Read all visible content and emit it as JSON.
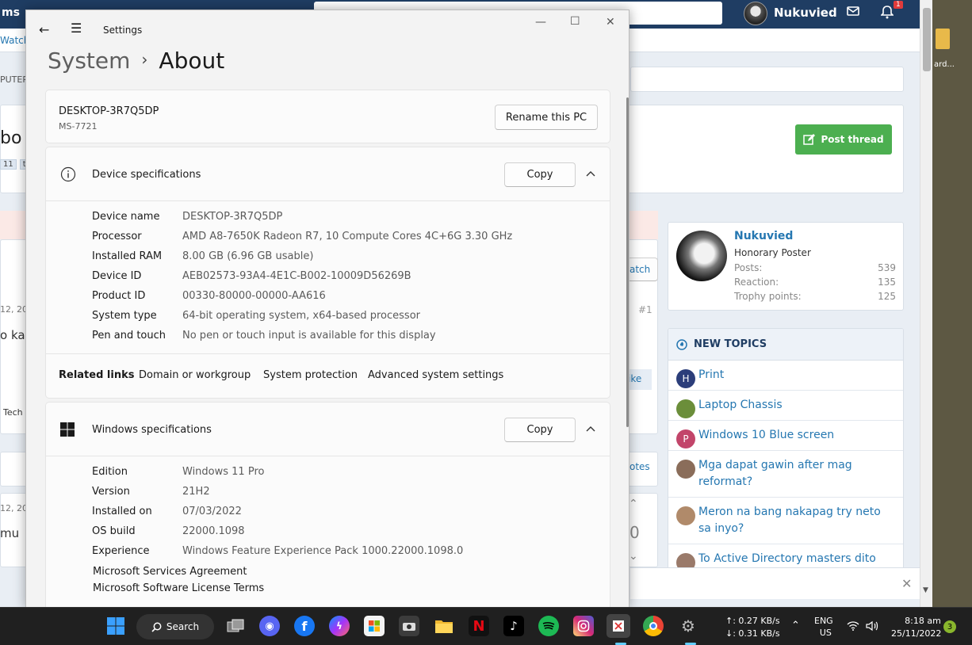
{
  "background_forum": {
    "nav_partial": "ms",
    "watch_partial": "Watch",
    "computer_partial": "PUTER",
    "title_partial": "bo",
    "tags": [
      "11",
      "t"
    ],
    "date_partial_1": "12, 202",
    "text_partial_1": "o ka",
    "tech_partial": "Tech",
    "date_partial_2": "12, 202",
    "text_partial_2": "mu",
    "watch_btn_partial": "atch",
    "post_number": "#1",
    "like_partial": "ike",
    "votes_partial": "otes",
    "vote_count": "0",
    "user_name": "Nukuvied",
    "post_thread_label": "Post thread",
    "desktop_label": "ard...",
    "profile": {
      "name": "Nukuvied",
      "rank": "Honorary Poster",
      "stats": [
        {
          "label": "Posts:",
          "value": "539"
        },
        {
          "label": "Reaction:",
          "value": "135"
        },
        {
          "label": "Trophy points:",
          "value": "125"
        }
      ]
    },
    "new_topics": {
      "heading": "NEW TOPICS",
      "items": [
        {
          "title": "Print",
          "avatar_letter": "H",
          "avatar_color": "#2c3e7a"
        },
        {
          "title": "Laptop Chassis",
          "avatar_letter": "",
          "avatar_color": "#6b8e3a"
        },
        {
          "title": "Windows 10 Blue screen",
          "avatar_letter": "P",
          "avatar_color": "#c2456a"
        },
        {
          "title": "Mga dapat gawin after mag reformat?",
          "avatar_letter": "",
          "avatar_color": "#8a6d5a"
        },
        {
          "title": "Meron na bang nakapag try neto sa inyo?",
          "avatar_letter": "",
          "avatar_color": "#b08a6a"
        },
        {
          "title": "To Active Directory masters dito",
          "avatar_letter": "",
          "avatar_color": "#9a7a6a"
        }
      ]
    }
  },
  "settings": {
    "window_title": "Settings",
    "breadcrumb_parent": "System",
    "breadcrumb_current": "About",
    "pc_name": "DESKTOP-3R7Q5DP",
    "pc_model": "MS-7721",
    "rename_button": "Rename this PC",
    "device_specs": {
      "heading": "Device specifications",
      "copy_button": "Copy",
      "rows": [
        {
          "label": "Device name",
          "value": "DESKTOP-3R7Q5DP"
        },
        {
          "label": "Processor",
          "value": "AMD A8-7650K Radeon R7, 10 Compute Cores 4C+6G    3.30 GHz"
        },
        {
          "label": "Installed RAM",
          "value": "8.00 GB (6.96 GB usable)"
        },
        {
          "label": "Device ID",
          "value": "AEB02573-93A4-4E1C-B002-10009D56269B"
        },
        {
          "label": "Product ID",
          "value": "00330-80000-00000-AA616"
        },
        {
          "label": "System type",
          "value": "64-bit operating system, x64-based processor"
        },
        {
          "label": "Pen and touch",
          "value": "No pen or touch input is available for this display"
        }
      ]
    },
    "related_links": {
      "label": "Related links",
      "links": [
        "Domain or workgroup",
        "System protection",
        "Advanced system settings"
      ]
    },
    "windows_specs": {
      "heading": "Windows specifications",
      "copy_button": "Copy",
      "rows": [
        {
          "label": "Edition",
          "value": "Windows 11 Pro"
        },
        {
          "label": "Version",
          "value": "21H2"
        },
        {
          "label": "Installed on",
          "value": "07/03/2022"
        },
        {
          "label": "OS build",
          "value": "22000.1098"
        },
        {
          "label": "Experience",
          "value": "Windows Feature Experience Pack 1000.22000.1098.0"
        }
      ],
      "links": [
        "Microsoft Services Agreement",
        "Microsoft Software License Terms"
      ]
    }
  },
  "taskbar": {
    "search_label": "Search",
    "net_up": "↑: 0.27 KB/s",
    "net_down": "↓: 0.31 KB/s",
    "lang": "ENG",
    "region": "US",
    "time": "8:18 am",
    "date": "25/11/2022",
    "notification_count": "3",
    "icons": [
      "start-icon",
      "search-icon",
      "task-view-icon",
      "discord-icon",
      "facebook-icon",
      "messenger-icon",
      "store-icon",
      "camera-icon",
      "file-explorer-icon",
      "netflix-icon",
      "tiktok-icon",
      "spotify-icon",
      "instagram-icon",
      "snipping-tool-icon",
      "chrome-icon",
      "settings-icon"
    ]
  }
}
